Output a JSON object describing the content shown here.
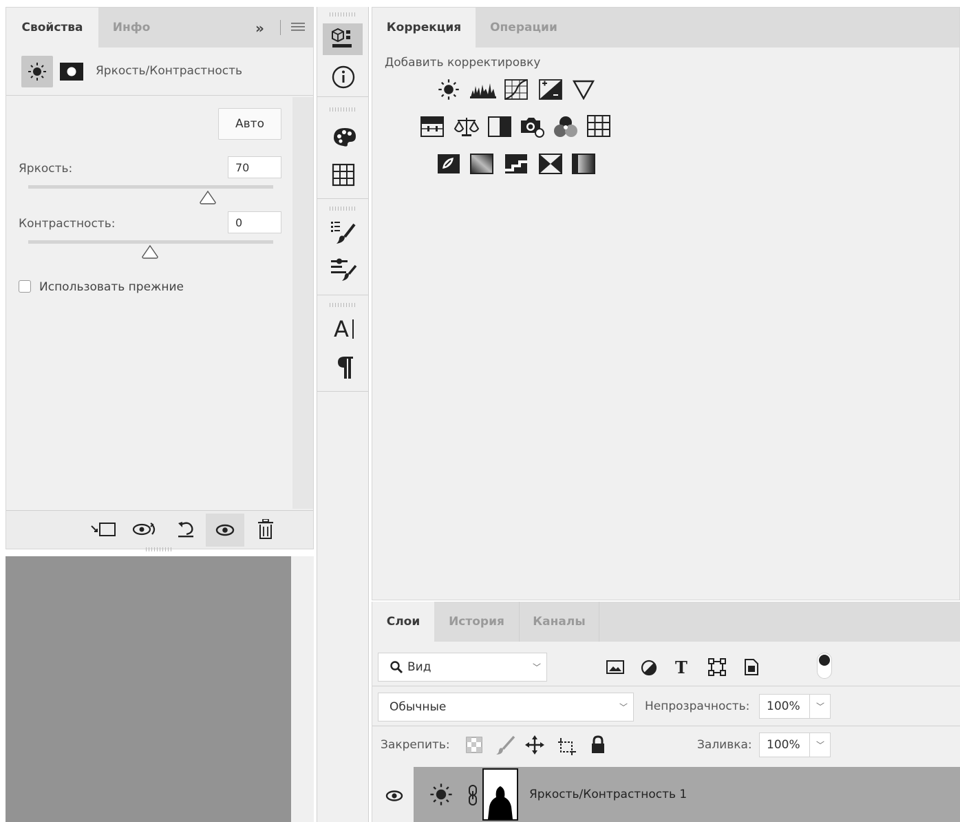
{
  "properties_panel": {
    "tabs": [
      "Свойства",
      "Инфо"
    ],
    "tab_overflow": "»",
    "adjustment_title": "Яркость/Контрастность",
    "auto_label": "Авто",
    "brightness": {
      "label": "Яркость:",
      "value": "70"
    },
    "contrast": {
      "label": "Контрастность:",
      "value": "0"
    },
    "use_legacy_label": "Использовать прежние"
  },
  "correction_panel": {
    "tabs": [
      "Коррекция",
      "Операции"
    ],
    "add_adjustment_label": "Добавить корректировку"
  },
  "layers_panel": {
    "tabs": [
      "Слои",
      "История",
      "Каналы"
    ],
    "filter_label": "Вид",
    "blend_mode": "Обычные",
    "opacity_label": "Непрозрачность:",
    "opacity_value": "100%",
    "lock_label": "Закрепить:",
    "fill_label": "Заливка:",
    "fill_value": "100%",
    "layer_name": "Яркость/Контрастность 1"
  }
}
